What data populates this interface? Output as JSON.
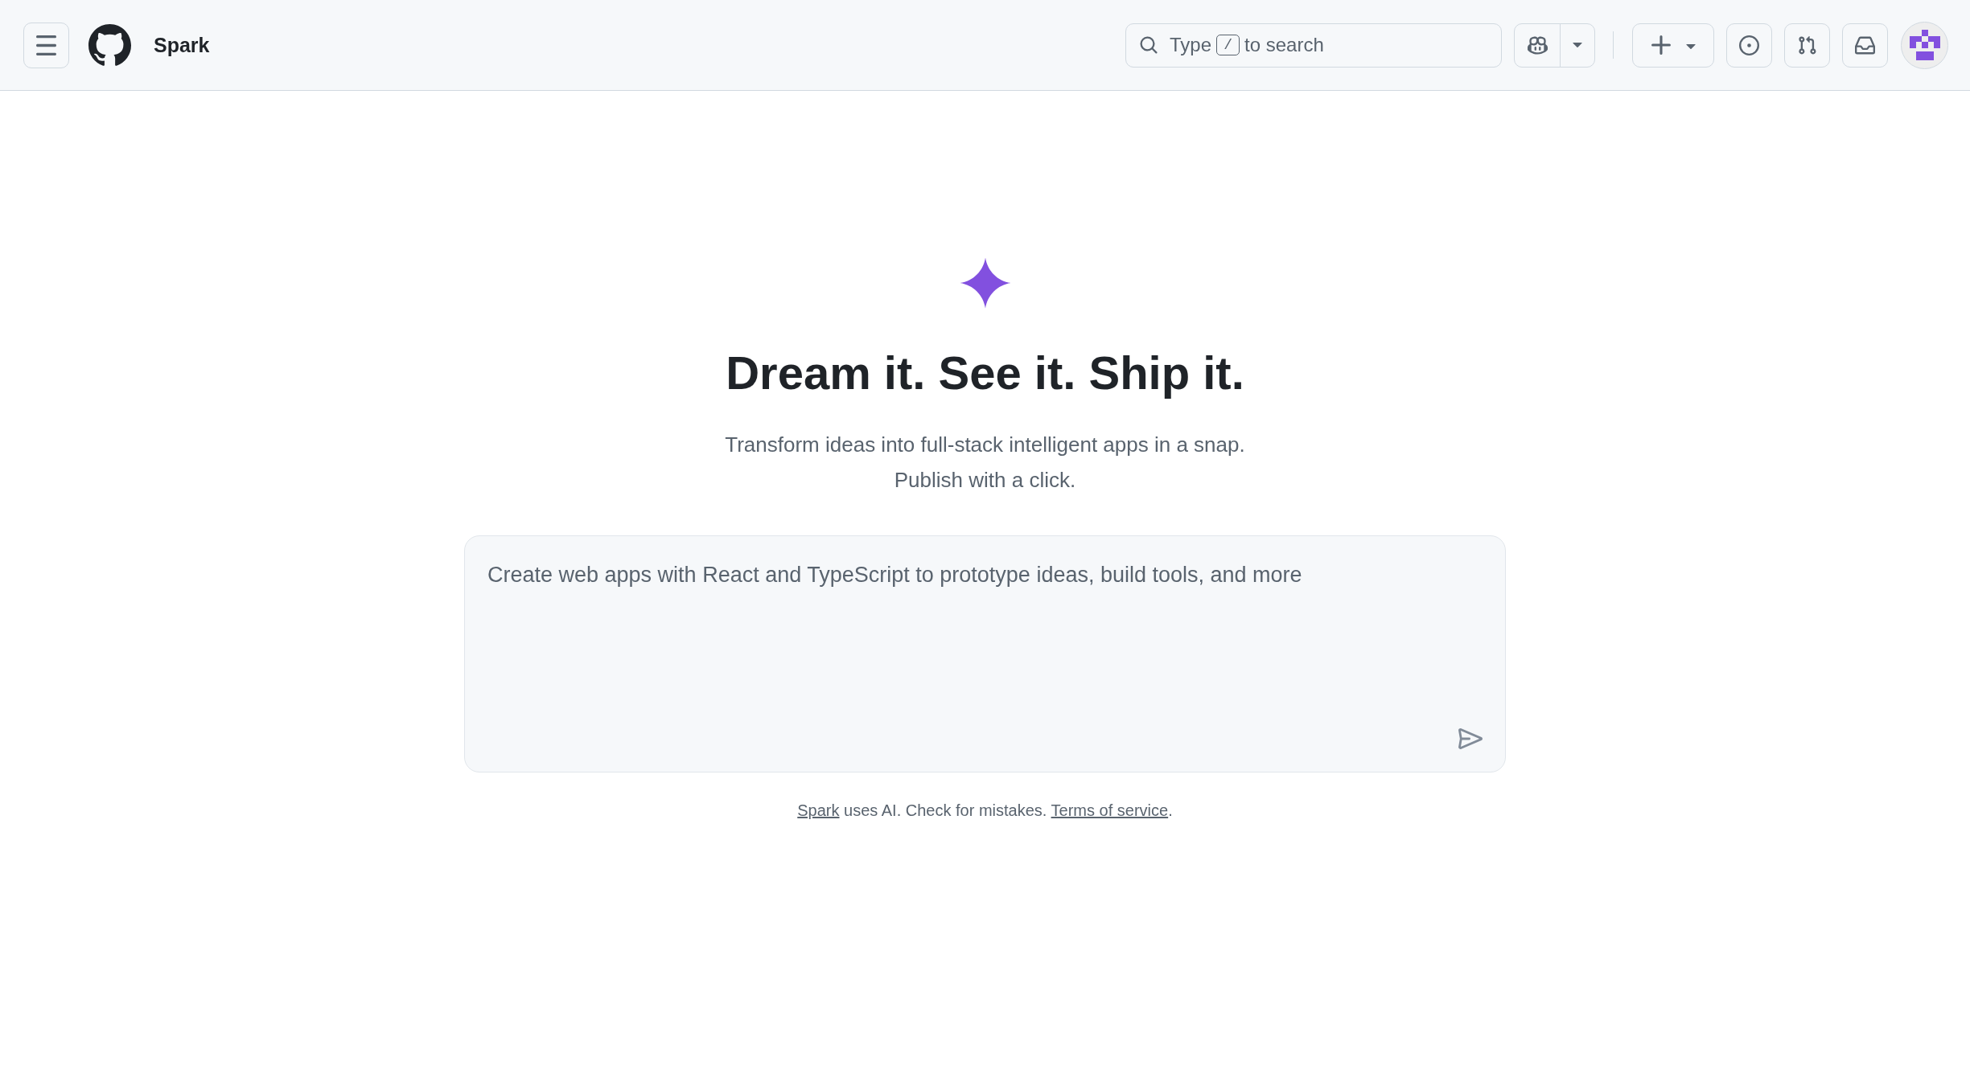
{
  "header": {
    "title": "Spark",
    "search": {
      "label_start": "Type",
      "shortcut_key": "/",
      "label_end": "to search"
    }
  },
  "hero": {
    "heading": "Dream it. See it. Ship it.",
    "subtitle_lines": [
      "Transform ideas into full-stack intelligent apps in a snap.",
      "Publish with a click."
    ]
  },
  "prompt": {
    "placeholder": "Create web apps with React and TypeScript to prototype ideas, build tools, and more"
  },
  "footer": {
    "parts": [
      {
        "kind": "link",
        "text": "Spark"
      },
      {
        "kind": "text",
        "text": " uses AI. Check for mistakes. "
      },
      {
        "kind": "link",
        "text": "Terms of service"
      },
      {
        "kind": "text",
        "text": "."
      }
    ]
  }
}
